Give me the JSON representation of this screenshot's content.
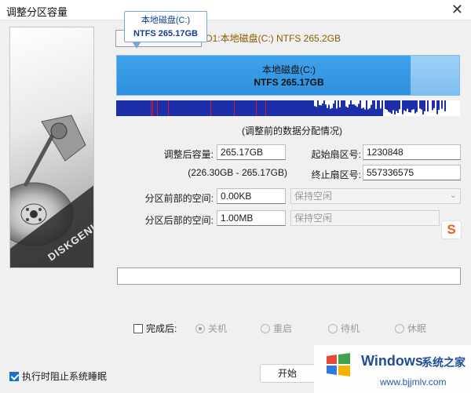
{
  "window": {
    "title": "调整分区容量",
    "close_glyph": "✕"
  },
  "tooltip": {
    "line1": "本地磁盘(C:)",
    "line2": "NTFS 265.17GB"
  },
  "disk": {
    "info": "D1:本地磁盘(C:) NTFS 265.2GB"
  },
  "partition": {
    "name": "本地磁盘(C:)",
    "detail": "NTFS 265.17GB"
  },
  "caption": "(调整前的数据分配情况)",
  "form": {
    "size_label": "调整后容量:",
    "size_value": "265.17GB",
    "range_text": "(226.30GB - 265.17GB)",
    "start_sector_label": "起始扇区号:",
    "start_sector_value": "1230848",
    "end_sector_label": "终止扇区号:",
    "end_sector_value": "557336575",
    "before_label": "分区前部的空间:",
    "before_value": "0.00KB",
    "before_option": "保持空闲",
    "after_label": "分区后部的空间:",
    "after_value": "1.00MB",
    "after_option": "保持空闲"
  },
  "ime_icon": "S",
  "completion": {
    "label": "完成后:",
    "options": [
      "关机",
      "重启",
      "待机",
      "休眠"
    ]
  },
  "block_sleep_label": "执行时阻止系统睡眠",
  "start_button": "开始",
  "watermark": {
    "brand": "Windows",
    "brand2": "系统之家",
    "url": "www.bjjmlv.com"
  },
  "colors": {
    "partition_blue": "#2f8fde",
    "free_blue": "#7fbff0",
    "accent": "#1d6fcc"
  }
}
